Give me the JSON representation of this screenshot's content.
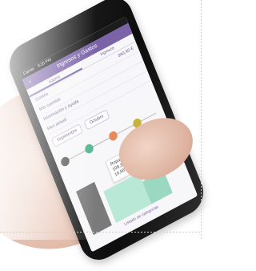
{
  "status": {
    "carrier": "Carrier",
    "time": "5:25 PM"
  },
  "appbar": {
    "title": "Ingresos y Gastos"
  },
  "tabs": [
    {
      "label": "Gastos"
    },
    {
      "label": "Ingresos"
    }
  ],
  "rows": [
    {
      "label": "Gastos",
      "value": "340,40 €"
    },
    {
      "label": "Mis cuentas",
      "value": ""
    },
    {
      "label": "Información y ayuda",
      "value": ""
    },
    {
      "label": "Mes actual",
      "value": ""
    }
  ],
  "months": [
    {
      "label": "Septiembre"
    },
    {
      "label": "Octubre"
    }
  ],
  "timeline": {
    "dots": [
      {
        "color": "#555555"
      },
      {
        "color": "#53b88f"
      },
      {
        "color": "#e68a5c"
      },
      {
        "color": "#c9b23a"
      }
    ]
  },
  "tooltip": {
    "line1": "Ropa y calzado",
    "line2": "108,35 €",
    "line3": "19,56%"
  },
  "footer": {
    "label": "Listado de categorías"
  }
}
